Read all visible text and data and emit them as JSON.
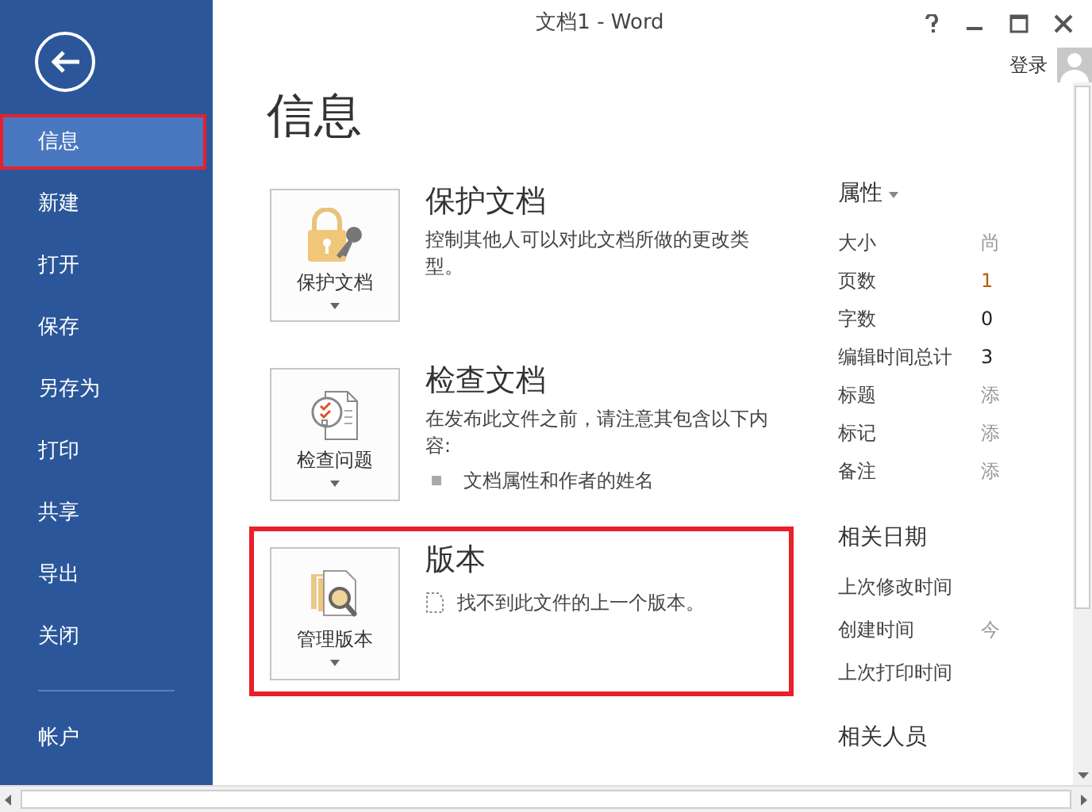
{
  "window": {
    "title": "文档1 - Word",
    "sign_in": "登录"
  },
  "sidebar": {
    "items": [
      {
        "label": "信息",
        "selected": true,
        "highlighted": true
      },
      {
        "label": "新建",
        "selected": false,
        "highlighted": false
      },
      {
        "label": "打开",
        "selected": false,
        "highlighted": false
      },
      {
        "label": "保存",
        "selected": false,
        "highlighted": false
      },
      {
        "label": "另存为",
        "selected": false,
        "highlighted": false
      },
      {
        "label": "打印",
        "selected": false,
        "highlighted": false
      },
      {
        "label": "共享",
        "selected": false,
        "highlighted": false
      },
      {
        "label": "导出",
        "selected": false,
        "highlighted": false
      },
      {
        "label": "关闭",
        "selected": false,
        "highlighted": false
      }
    ],
    "footer_items": [
      {
        "label": "帐户",
        "selected": false
      }
    ]
  },
  "page_title": "信息",
  "sections": [
    {
      "kind": "protect",
      "button": "保护文档",
      "title": "保护文档",
      "description": "控制其他人可以对此文档所做的更改类型。",
      "highlighted": false
    },
    {
      "kind": "inspect",
      "button": "检查问题",
      "title": "检查文档",
      "description": "在发布此文件之前，请注意其包含以下内容:",
      "bullets": [
        "文档属性和作者的姓名"
      ],
      "highlighted": false
    },
    {
      "kind": "versions",
      "button": "管理版本",
      "title": "版本",
      "description": "找不到此文件的上一个版本。",
      "highlighted": true
    }
  ],
  "properties": {
    "title": "属性",
    "rows": [
      {
        "label": "大小",
        "value": "尚",
        "muted": true
      },
      {
        "label": "页数",
        "value": "1",
        "muted": false
      },
      {
        "label": "字数",
        "value": "0",
        "muted": false
      },
      {
        "label": "编辑时间总计",
        "value": "3",
        "muted": false
      },
      {
        "label": "标题",
        "value": "添",
        "muted": true
      },
      {
        "label": "标记",
        "value": "添",
        "muted": true
      },
      {
        "label": "备注",
        "value": "添",
        "muted": true
      }
    ]
  },
  "related_dates": {
    "title": "相关日期",
    "rows": [
      {
        "label": "上次修改时间"
      },
      {
        "label": "创建时间",
        "value": "今"
      },
      {
        "label": "上次打印时间"
      }
    ]
  },
  "related_people": {
    "title": "相关人员"
  }
}
